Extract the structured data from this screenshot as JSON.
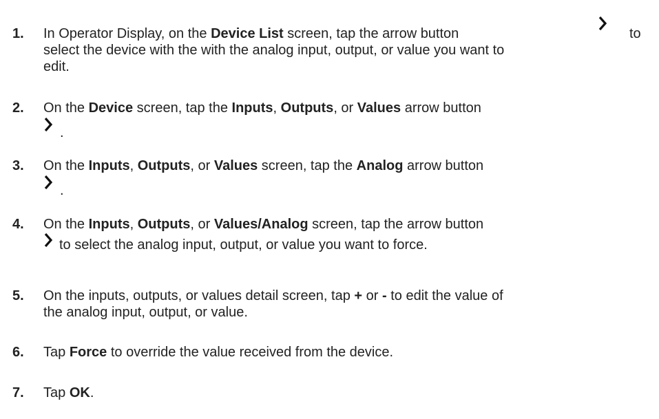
{
  "steps": [
    {
      "number": "1.",
      "line1_a": "In Operator Display, on the ",
      "line1_b": "Device List",
      "line1_c": " screen, tap the arrow button",
      "line1_d": "to",
      "line2": "select the device with the with the analog input, output, or value you want to",
      "line3": "edit.",
      "icon": "chevron-right-icon"
    },
    {
      "number": "2.",
      "a": "On the ",
      "b": "Device",
      "c": " screen, tap the ",
      "d": "Inputs",
      "e": ", ",
      "f": "Outputs",
      "g": ", or ",
      "h": "Values",
      "i": " arrow button",
      "period": ".",
      "icon": "chevron-right-icon"
    },
    {
      "number": "3.",
      "a": "On the ",
      "b": "Inputs",
      "c": ", ",
      "d": "Outputs",
      "e": ", or ",
      "f": "Values",
      "g": " screen, tap the ",
      "h": "Analog",
      "i": " arrow button",
      "period": ".",
      "icon": "chevron-right-icon"
    },
    {
      "number": "4.",
      "a": "On the ",
      "b": "Inputs",
      "c": ", ",
      "d": "Outputs",
      "e": ", or ",
      "f": "Values/Analog",
      "g": " screen, tap the arrow button",
      "line2": "to select the analog input, output, or value you want to force.",
      "icon": "chevron-right-icon"
    },
    {
      "number": "5.",
      "a": "On the inputs, outputs, or values detail screen, tap ",
      "b": "+",
      "c": " or ",
      "d": "-",
      "e": " to edit the value of",
      "line2": "the analog input, output, or value."
    },
    {
      "number": "6.",
      "a": "Tap ",
      "b": "Force",
      "c": " to override the value received from the device."
    },
    {
      "number": "7.",
      "a": "Tap ",
      "b": "OK",
      "c": "."
    }
  ]
}
